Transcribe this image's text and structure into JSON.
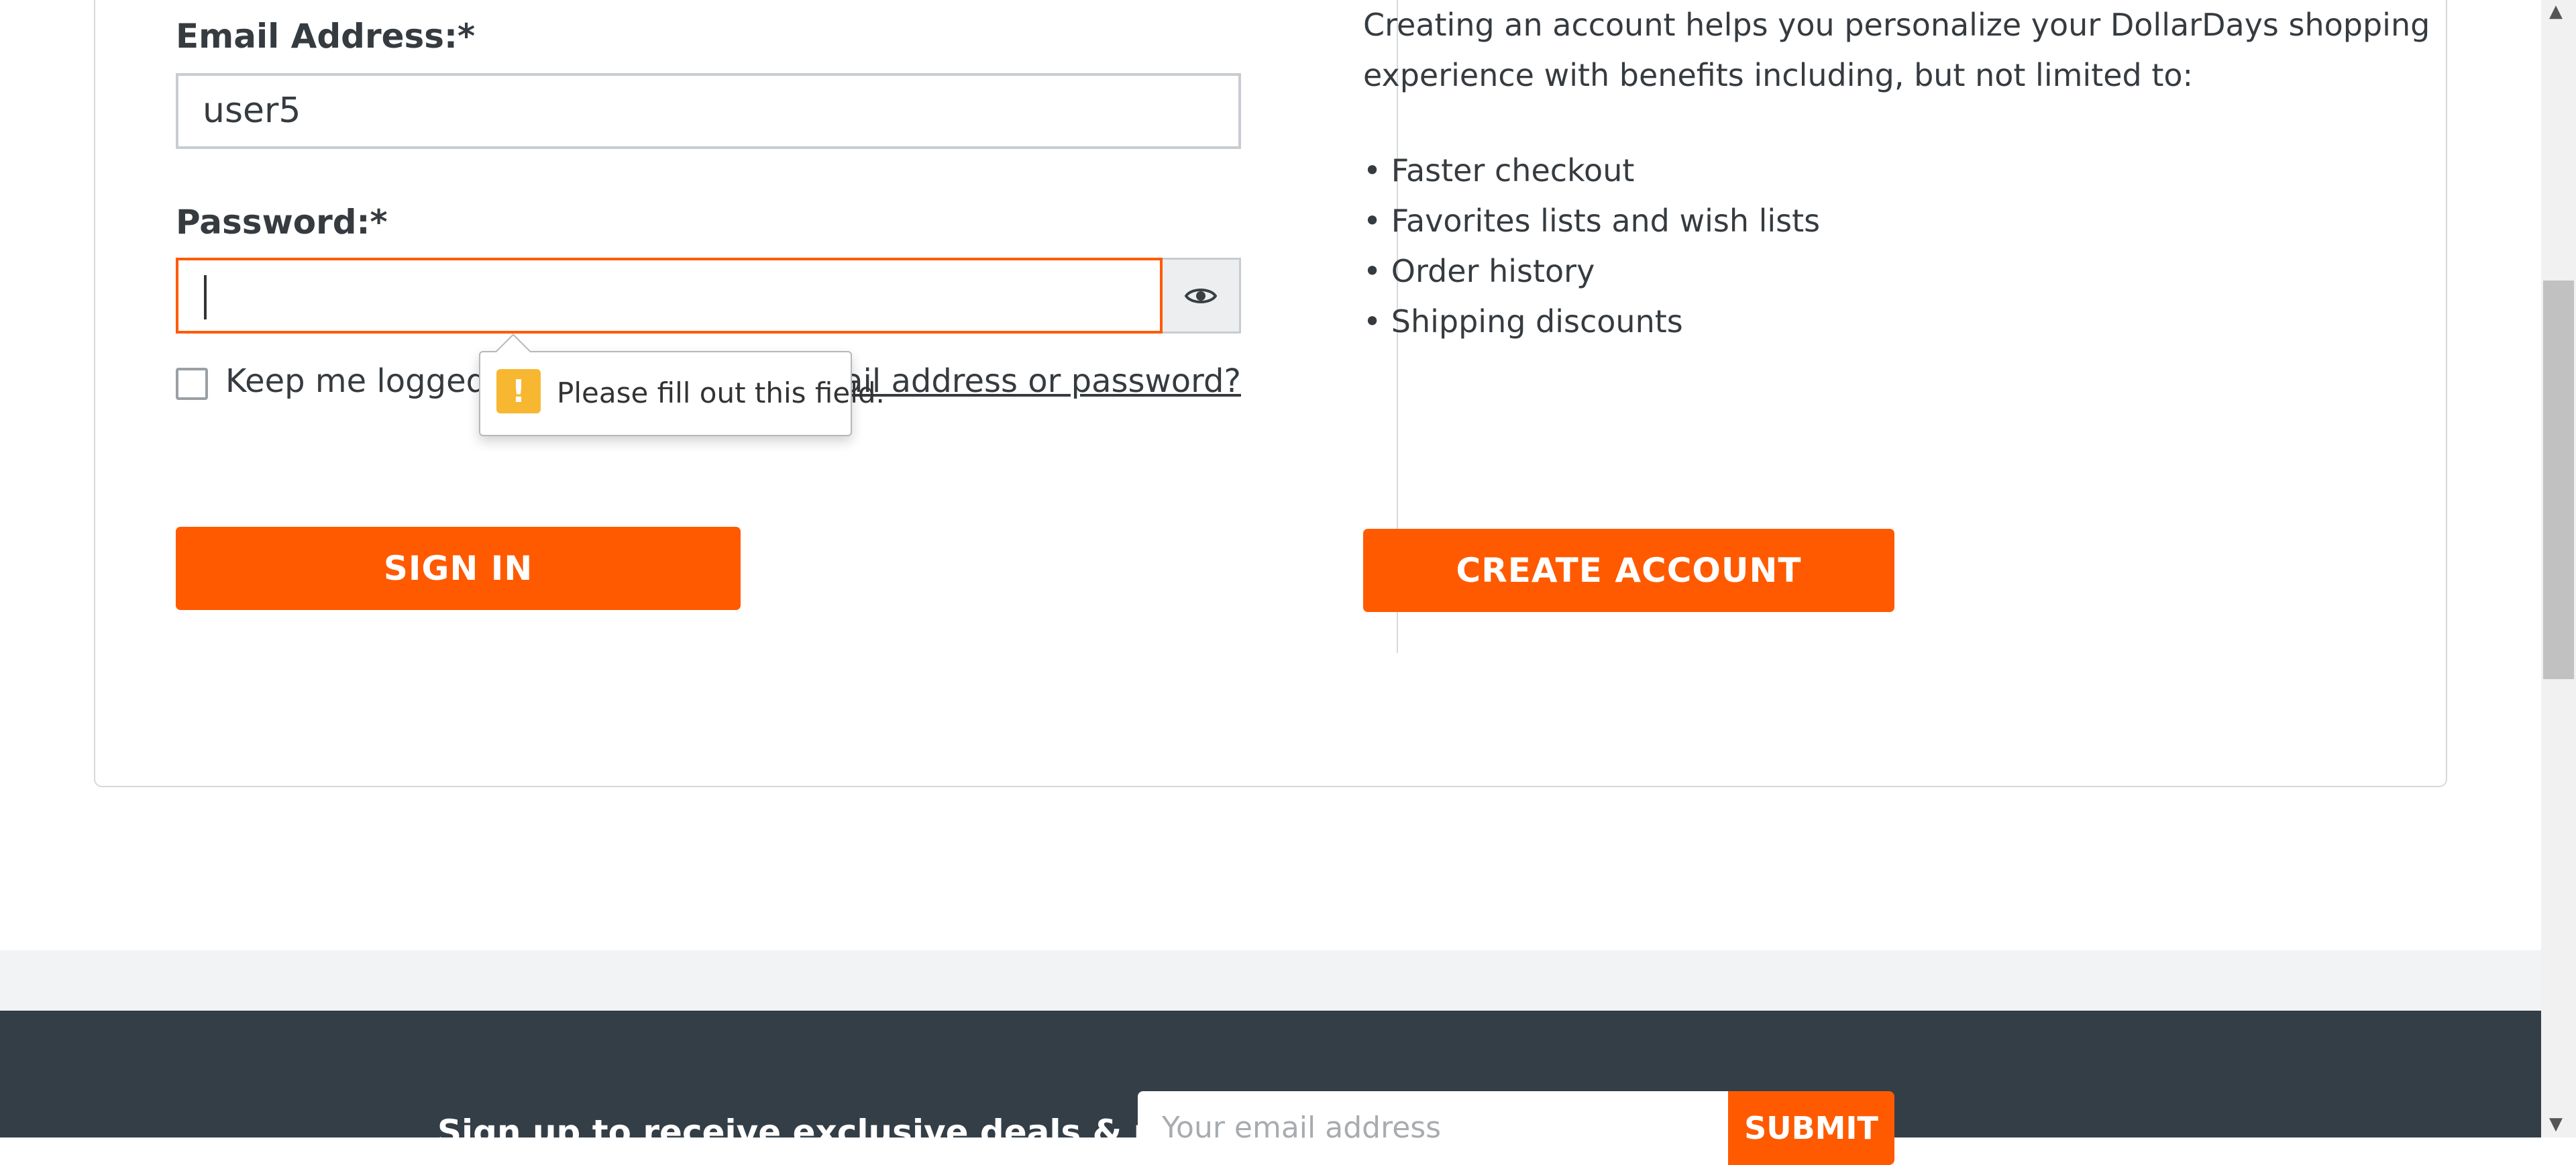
{
  "signin": {
    "email_label": "Email Address:*",
    "email_value": "user5",
    "password_label": "Password:*",
    "password_value": "",
    "keep_logged_in_label": "Keep me logged in",
    "forgot_link": "Forgot your email address or password?",
    "sign_in_button": "SIGN IN",
    "validation_tooltip": "Please fill out this field."
  },
  "register": {
    "intro": "Creating an account helps you personalize your DollarDays shopping experience with benefits including, but not limited to:",
    "benefits": [
      "• Faster checkout",
      "• Favorites lists and wish lists",
      "• Order history",
      "• Shipping discounts"
    ],
    "create_button": "CREATE ACCOUNT"
  },
  "footer": {
    "signup_text": "Sign up to receive exclusive deals & more!",
    "email_placeholder": "Your email address",
    "submit_button": "SUBMIT"
  },
  "colors": {
    "accent": "#ff5a00",
    "footer_bg": "#343e47",
    "warning": "#f7b731"
  }
}
